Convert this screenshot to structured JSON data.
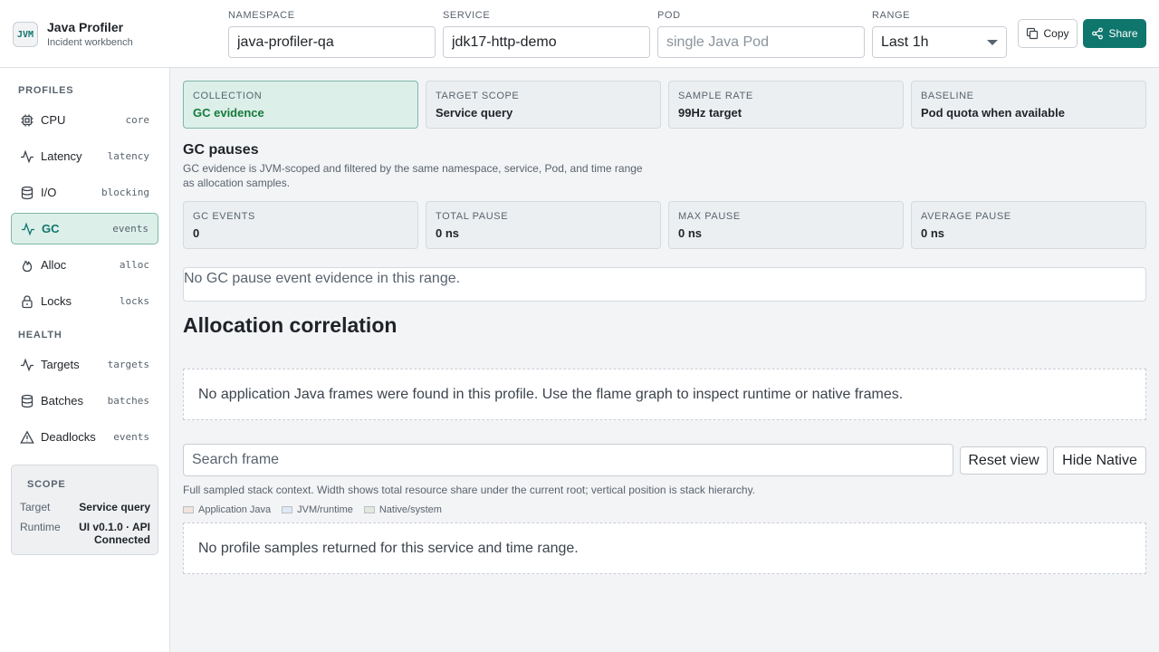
{
  "brand": {
    "logo": "JVM",
    "title": "Java Profiler",
    "subtitle": "Incident workbench"
  },
  "filters": {
    "namespace": {
      "label": "NAMESPACE",
      "value": "java-profiler-qa"
    },
    "service": {
      "label": "SERVICE",
      "value": "jdk17-http-demo"
    },
    "pod": {
      "label": "POD",
      "value": "",
      "placeholder": "single Java Pod"
    },
    "range": {
      "label": "RANGE",
      "value": "Last 1h"
    }
  },
  "actions": {
    "copy": "Copy",
    "share": "Share"
  },
  "colors": {
    "accent": "#0f766e",
    "active_bg": "#dcefe9",
    "active_value": "#157a3a"
  },
  "sidebar": {
    "profiles_title": "PROFILES",
    "profiles": [
      {
        "label": "CPU",
        "tag": "core",
        "icon": "cpu-icon"
      },
      {
        "label": "Latency",
        "tag": "latency",
        "icon": "activity-icon"
      },
      {
        "label": "I/O",
        "tag": "blocking",
        "icon": "database-icon"
      },
      {
        "label": "GC",
        "tag": "events",
        "icon": "activity-icon",
        "active": true
      },
      {
        "label": "Alloc",
        "tag": "alloc",
        "icon": "flame-icon"
      },
      {
        "label": "Locks",
        "tag": "locks",
        "icon": "lock-icon"
      }
    ],
    "health_title": "HEALTH",
    "health": [
      {
        "label": "Targets",
        "tag": "targets",
        "icon": "activity-icon"
      },
      {
        "label": "Batches",
        "tag": "batches",
        "icon": "database-icon"
      },
      {
        "label": "Deadlocks",
        "tag": "events",
        "icon": "warning-icon"
      }
    ],
    "scope": {
      "title": "SCOPE",
      "target_key": "Target",
      "target_value": "Service query",
      "runtime_key": "Runtime",
      "runtime_value": "UI v0.1.0 · API Connected"
    }
  },
  "summary": [
    {
      "label": "COLLECTION",
      "value": "GC evidence",
      "active": true
    },
    {
      "label": "TARGET SCOPE",
      "value": "Service query"
    },
    {
      "label": "SAMPLE RATE",
      "value": "99Hz target"
    },
    {
      "label": "BASELINE",
      "value": "Pod quota when available"
    }
  ],
  "gc": {
    "title": "GC pauses",
    "description": "GC evidence is JVM-scoped and filtered by the same namespace, service, Pod, and time range as allocation samples.",
    "metrics": [
      {
        "label": "GC EVENTS",
        "value": "0"
      },
      {
        "label": "TOTAL PAUSE",
        "value": "0 ns"
      },
      {
        "label": "MAX PAUSE",
        "value": "0 ns"
      },
      {
        "label": "AVERAGE PAUSE",
        "value": "0 ns"
      }
    ],
    "empty": "No GC pause event evidence in this range."
  },
  "allocation": {
    "title": "Allocation correlation",
    "no_frames": "No application Java frames were found in this profile. Use the flame graph to inspect runtime or native frames.",
    "search_placeholder": "Search frame",
    "reset": "Reset view",
    "hide_native": "Hide Native",
    "hint": "Full sampled stack context. Width shows total resource share under the current root; vertical position is stack hierarchy.",
    "legend": [
      {
        "label": "Application Java",
        "color": "#f1e4dc"
      },
      {
        "label": "JVM/runtime",
        "color": "#dfe8f6"
      },
      {
        "label": "Native/system",
        "color": "#e3e8dc"
      }
    ],
    "no_samples": "No profile samples returned for this service and time range."
  }
}
